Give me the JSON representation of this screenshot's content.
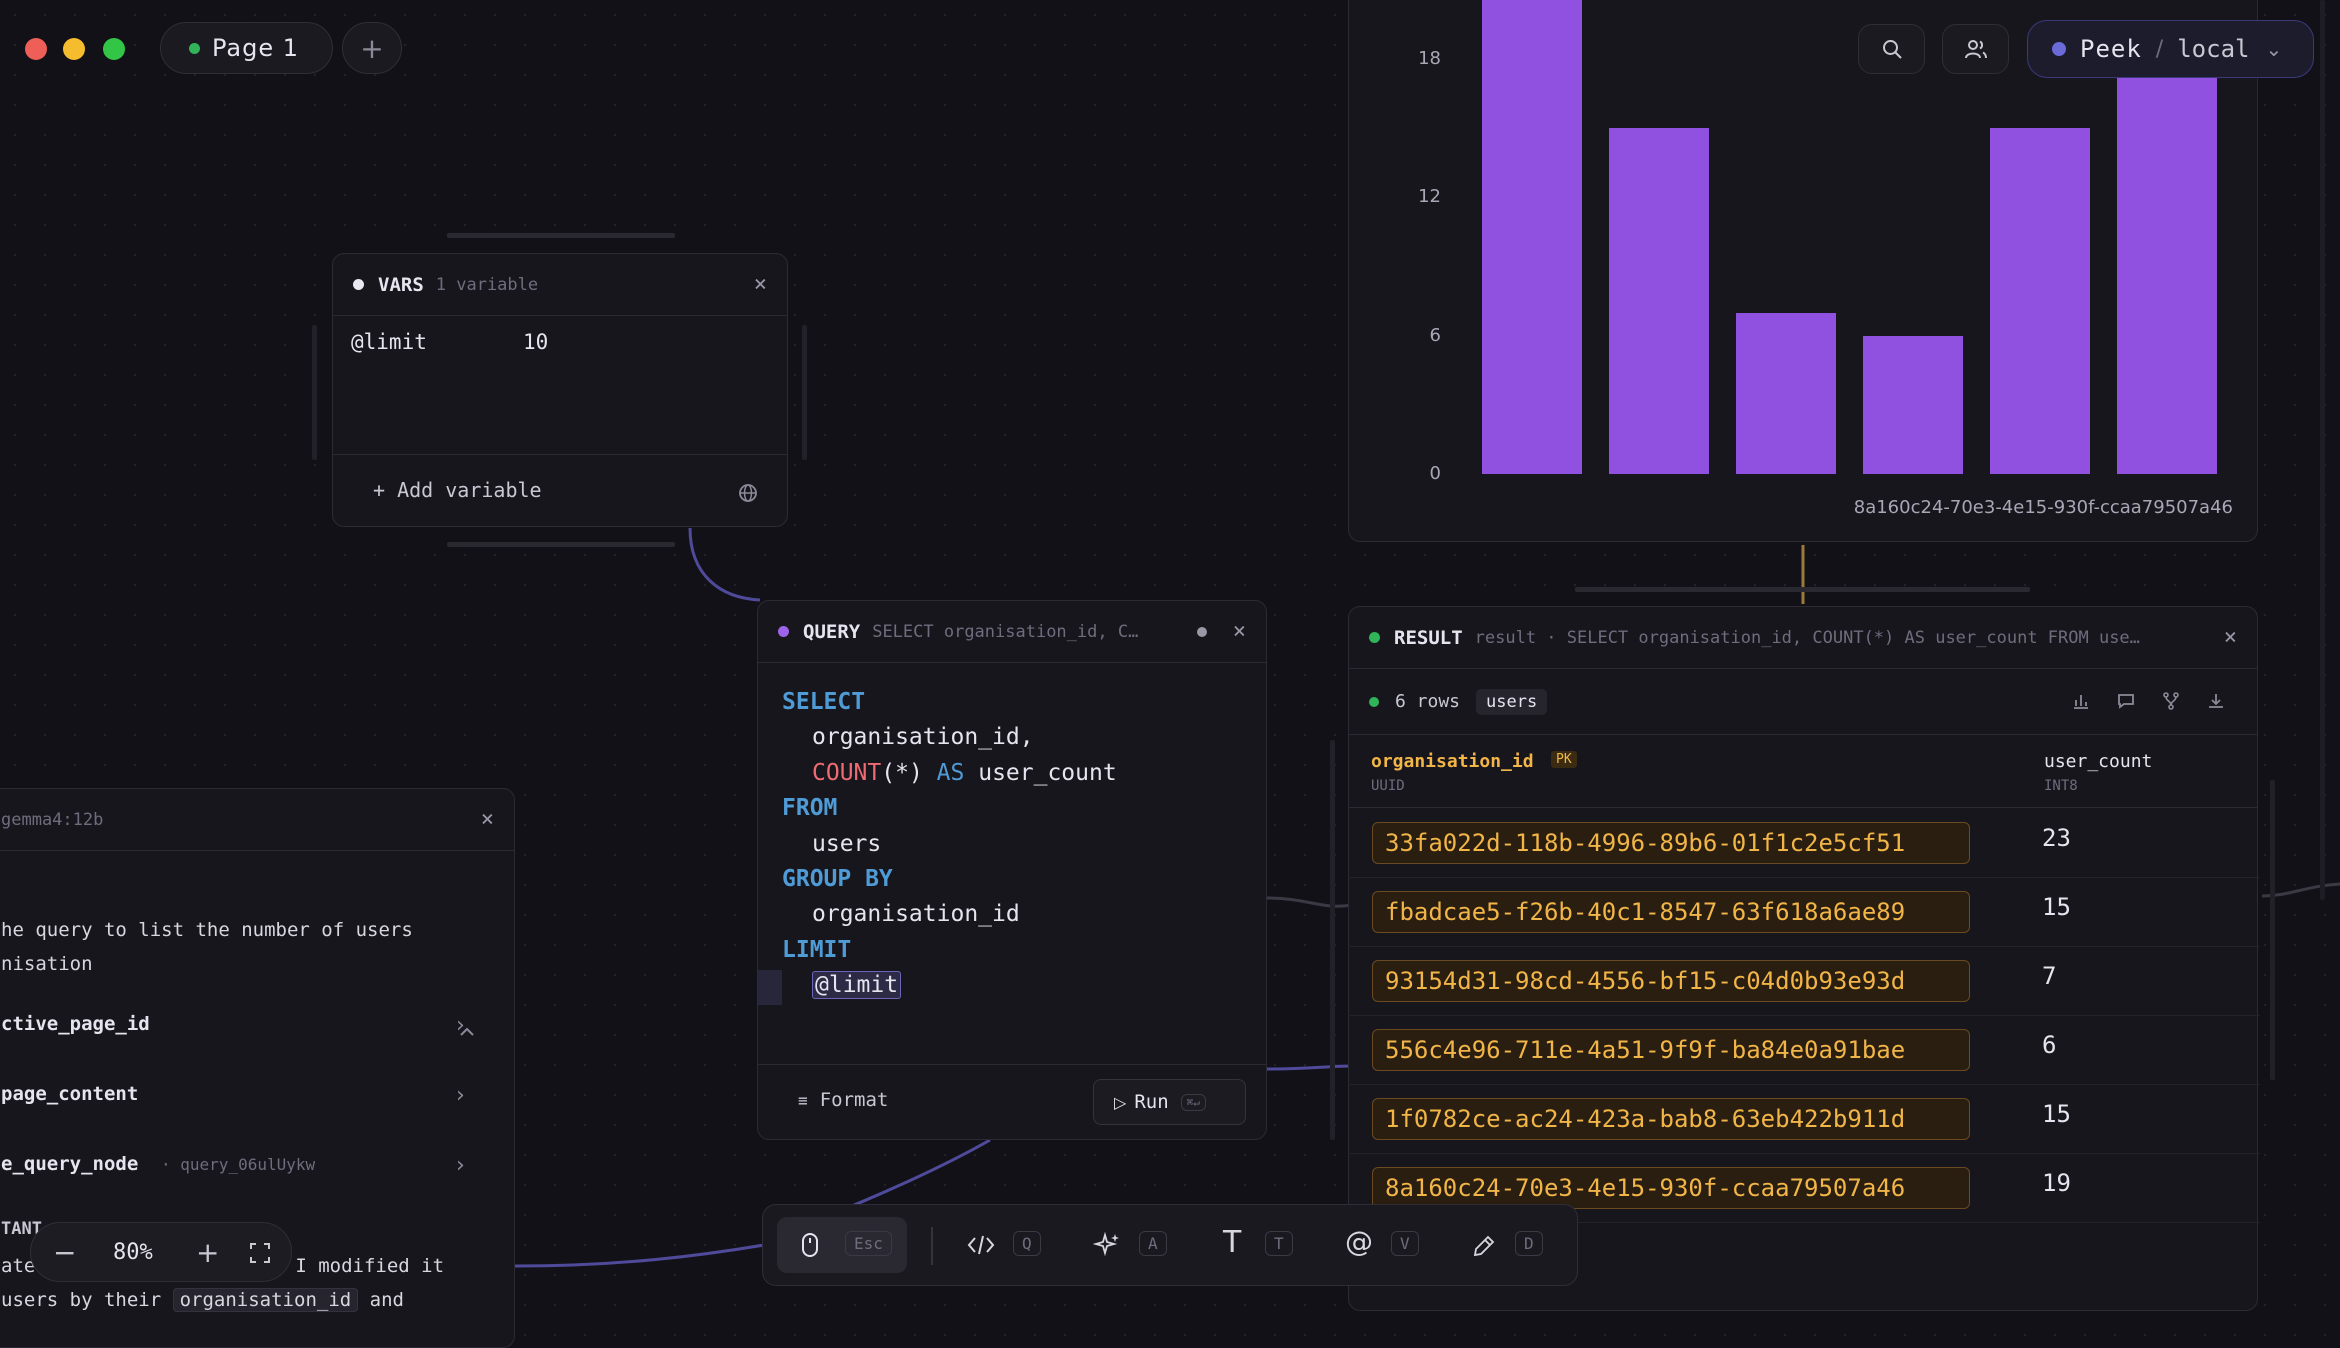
{
  "top": {
    "page_tab": "Page 1",
    "add_tab": "+",
    "connection_name": "Peek",
    "connection_sep": "/",
    "connection_env": "local",
    "connection_chevron": "⌄"
  },
  "vars": {
    "title": "VARS",
    "subtitle": "1 variable",
    "var_name": "@limit",
    "var_value": "10",
    "add_label": "+ Add variable"
  },
  "query": {
    "title": "QUERY",
    "subtitle": "SELECT organisation_id, C…",
    "lines": {
      "l1": "SELECT",
      "l2": "organisation_id,",
      "l3a": "COUNT",
      "l3b": "(*)",
      "l3c": "AS",
      "l3d": "user_count",
      "l4": "FROM",
      "l5": "users",
      "l6": "GROUP BY",
      "l7": "organisation_id",
      "l8": "LIMIT",
      "l9": "@limit"
    },
    "format_label": "Format",
    "run_label": "Run",
    "run_shortcut": "⌘↵"
  },
  "chart": {
    "caption": "8a160c24-70e3-4e15-930f-ccaa79507a46"
  },
  "chart_data": {
    "type": "bar",
    "categories": [
      "33fa022d-118b-4996-89b6-01f1c2e5cf51",
      "fbadcae5-f26b-40c1-8547-63f618a6ae89",
      "93154d31-98cd-4556-bf15-c04d0b93e93d",
      "556c4e96-711e-4a51-9f9f-ba84e0a91bae",
      "1f0782ce-ac24-423a-bab8-63eb422b911d",
      "8a160c24-70e3-4e15-930f-ccaa79507a46"
    ],
    "values": [
      23,
      15,
      7,
      6,
      15,
      19
    ],
    "yticks": [
      "0",
      "6",
      "12",
      "18"
    ],
    "ylim": [
      0,
      18
    ],
    "color": "#9151e0",
    "grid": false
  },
  "result": {
    "title": "RESULT",
    "subtitle": "result · SELECT organisation_id, COUNT(*) AS user_count FROM use…",
    "rows_label": "6 rows",
    "table_badge": "users",
    "col1_name": "organisation_id",
    "col1_pk": "PK",
    "col1_type": "UUID",
    "col2_name": "user_count",
    "col2_type": "INT8",
    "rows": [
      {
        "id": "33fa022d-118b-4996-89b6-01f1c2e5cf51",
        "count": "23"
      },
      {
        "id": "fbadcae5-f26b-40c1-8547-63f618a6ae89",
        "count": "15"
      },
      {
        "id": "93154d31-98cd-4556-bf15-c04d0b93e93d",
        "count": "7"
      },
      {
        "id": "556c4e96-711e-4a51-9f9f-ba84e0a91bae",
        "count": "6"
      },
      {
        "id": "1f0782ce-ac24-423a-bab8-63eb422b911d",
        "count": "15"
      },
      {
        "id": "8a160c24-70e3-4e15-930f-ccaa79507a46",
        "count": "19"
      }
    ]
  },
  "assistant": {
    "model": "gemma4:12b",
    "msg_line1": "he query to list the number of users",
    "msg_line2": "nisation",
    "tool1": "ctive_page_id",
    "tool2": "page_content",
    "tool3": "e_query_node",
    "tool3_ref": "· query_06ulUykw",
    "label": "TANT",
    "reply_l1a": "ate",
    "reply_l1b": "I modified it",
    "reply_l2a": "users by their",
    "reply_l2code": "organisation_id",
    "reply_l2b": "and"
  },
  "zoom": {
    "minus": "−",
    "level": "80%",
    "plus": "+"
  },
  "toolbar": {
    "select_key": "Esc",
    "code_key": "Q",
    "ai_key": "A",
    "text_glyph": "T",
    "text_key": "T",
    "mention_glyph": "@",
    "mention_key": "V",
    "draw_key": "D"
  }
}
